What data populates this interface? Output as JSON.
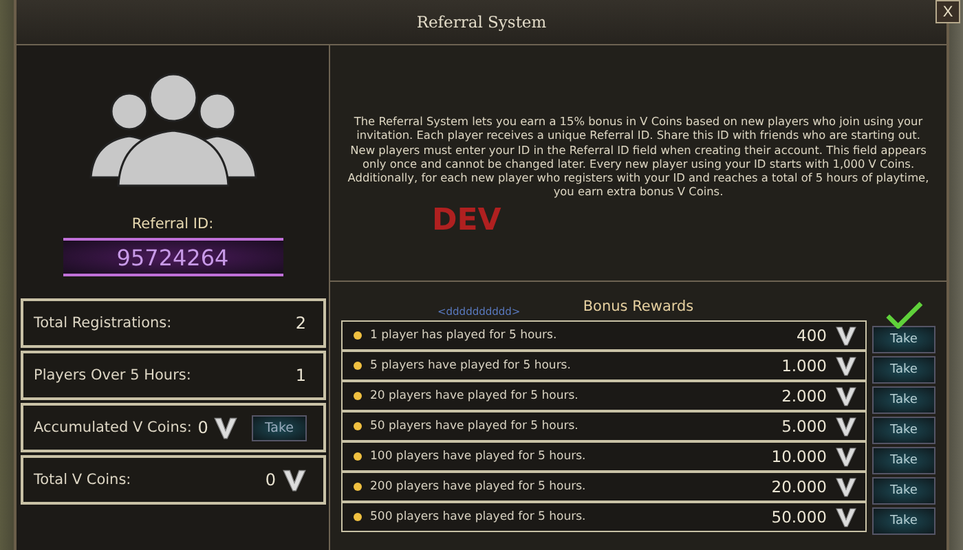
{
  "window": {
    "title": "Referral System",
    "close": "X"
  },
  "referral": {
    "label": "Referral ID:",
    "id": "95724264"
  },
  "stats": [
    {
      "kind": "plain",
      "label": "Total Registrations:",
      "value": "2"
    },
    {
      "kind": "plain",
      "label": "Players Over 5 Hours:",
      "value": "1"
    },
    {
      "kind": "take",
      "label": "Accumulated V Coins:",
      "value": "0",
      "button": "Take"
    },
    {
      "kind": "coin",
      "label": "Total V Coins:",
      "value": "0"
    }
  ],
  "description": "The Referral System lets you earn a 15% bonus in V Coins based on new players who join using your invitation. Each player receives a unique Referral ID. Share this ID with friends who are starting out. New players must enter your ID in the Referral ID field when creating their account. This field appears only once and cannot be changed later. Every new player using your ID starts with 1,000 V Coins. Additionally, for each new player who registers with your ID and reaches a total of 5 hours of playtime, you earn extra bonus V Coins.",
  "scene": {
    "emblem": "DEV",
    "name_tag": "<dddddddddd>"
  },
  "bonus_rewards": {
    "title": "Bonus Rewards",
    "rows": [
      {
        "text": "1 player has played for 5 hours.",
        "amount": "400",
        "button": "Take",
        "claimed": true
      },
      {
        "text": "5 players have played for 5 hours.",
        "amount": "1.000",
        "button": "Take",
        "claimed": false
      },
      {
        "text": "20 players have played for 5 hours.",
        "amount": "2.000",
        "button": "Take",
        "claimed": false
      },
      {
        "text": "50 players have played for 5 hours.",
        "amount": "5.000",
        "button": "Take",
        "claimed": false
      },
      {
        "text": "100 players have played for 5 hours.",
        "amount": "10.000",
        "button": "Take",
        "claimed": false
      },
      {
        "text": "200 players have played for 5 hours.",
        "amount": "20.000",
        "button": "Take",
        "claimed": false
      },
      {
        "text": "500 players have played for 5 hours.",
        "amount": "50.000",
        "button": "Take",
        "claimed": false
      }
    ]
  }
}
